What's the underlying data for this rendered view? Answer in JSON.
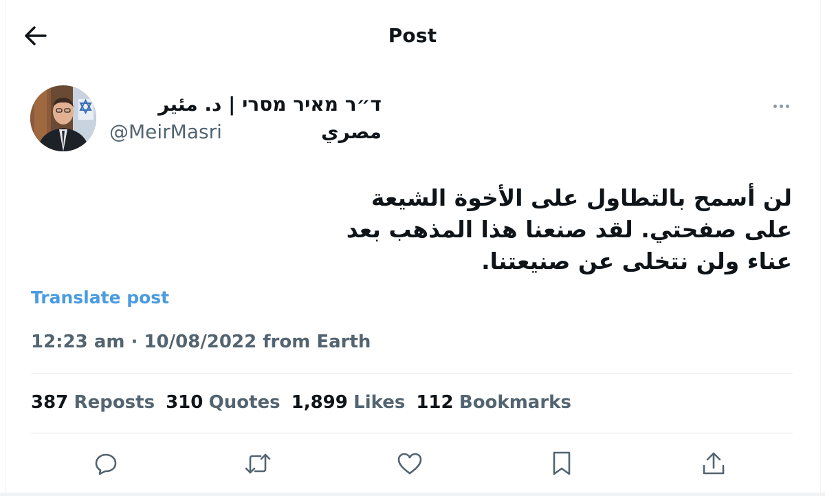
{
  "header": {
    "title": "Post",
    "back_icon": "arrow-left-icon"
  },
  "author": {
    "display_name": "ד״ר מאיר מסרי | د. مئير مصري",
    "handle": "@MeirMasri",
    "avatar_icon": "avatar"
  },
  "tweet": {
    "text": "لن أسمح بالتطاول على الأخوة الشيعة على صفحتي. لقد صنعنا هذا المذهب بعد عناء ولن نتخلى عن صنيعتنا.",
    "translate_label": "Translate post",
    "time": "12:23 am",
    "date": "10/08/2022",
    "source": "from Earth"
  },
  "stats": {
    "reposts": {
      "count": "387",
      "label": "Reposts"
    },
    "quotes": {
      "count": "310",
      "label": "Quotes"
    },
    "likes": {
      "count": "1,899",
      "label": "Likes"
    },
    "bookmarks": {
      "count": "112",
      "label": "Bookmarks"
    }
  },
  "actions": [
    "reply-icon",
    "repost-icon",
    "like-icon",
    "bookmark-icon",
    "share-icon"
  ],
  "colors": {
    "text": "#0f1419",
    "secondary": "#536471",
    "link": "#4a9be0",
    "divider": "#e1e6e8"
  }
}
